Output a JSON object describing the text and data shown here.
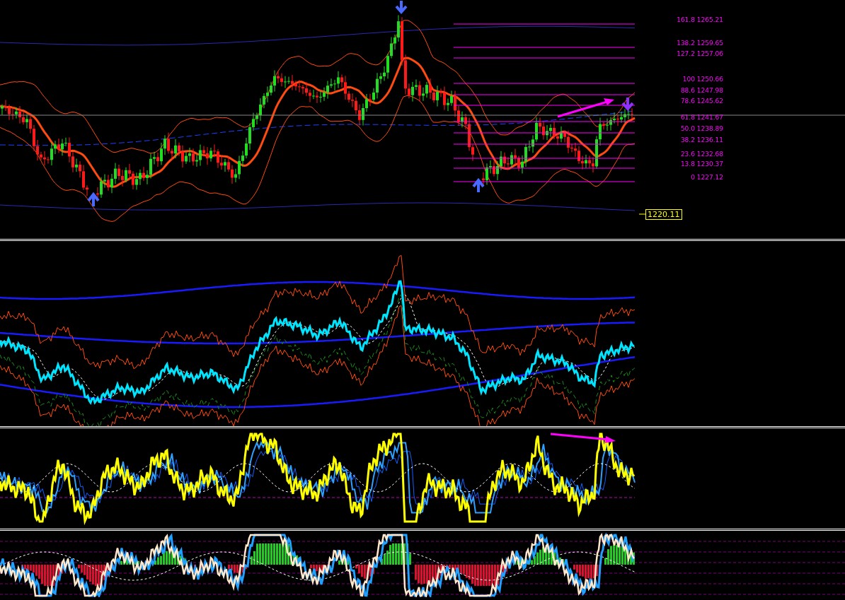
{
  "price_chart": {
    "fibonacci_levels": [
      {
        "label": "161.8 1265.21"
      },
      {
        "label": "138.2 1259.65"
      },
      {
        "label": "127.2 1257.06"
      },
      {
        "label": "100 1250.66"
      },
      {
        "label": "88.6 1247.98"
      },
      {
        "label": "78.6 1245.62"
      },
      {
        "label": "61.8 1241.67"
      },
      {
        "label": "50.0 1238.89"
      },
      {
        "label": "38.2 1236.11"
      },
      {
        "label": "23.6 1232.68"
      },
      {
        "label": "13.8 1230.37"
      },
      {
        "label": "0 1227.12"
      }
    ],
    "price_label": "1220.11"
  }
}
